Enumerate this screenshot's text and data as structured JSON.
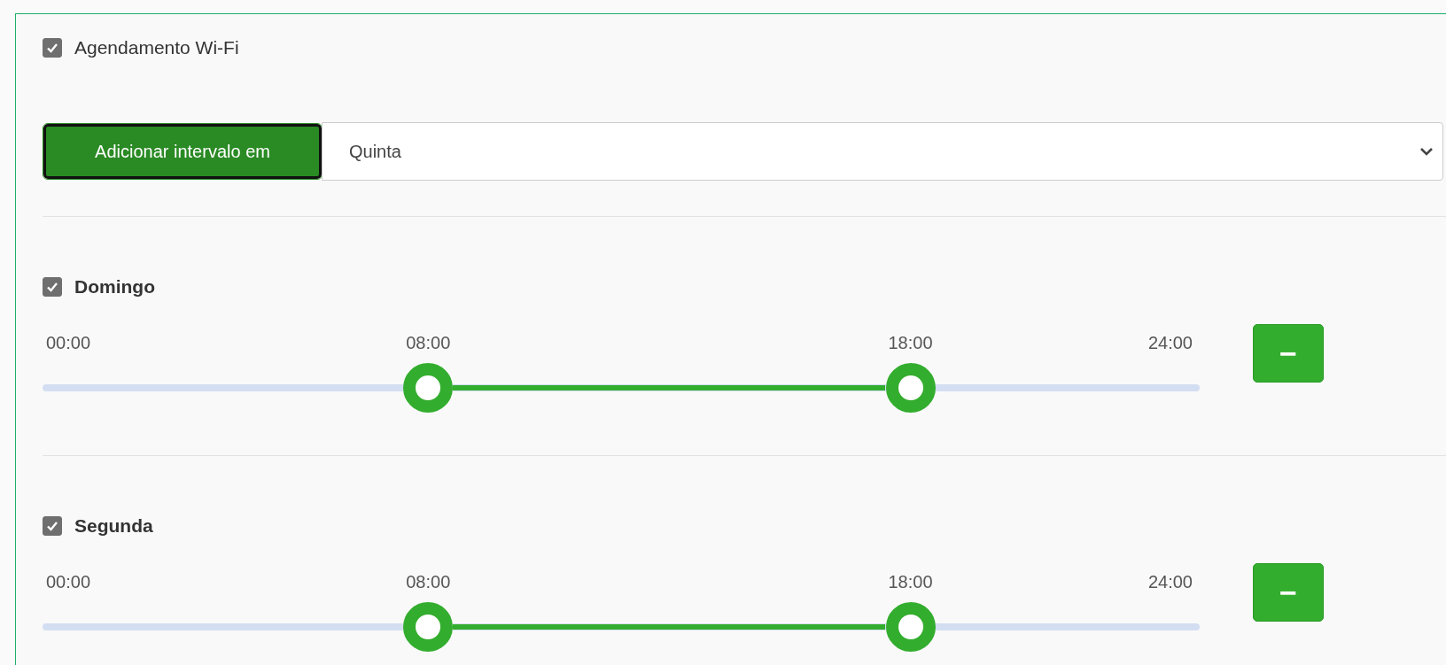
{
  "schedule": {
    "label": "Agendamento Wi-Fi",
    "checked": true
  },
  "add_interval": {
    "button": "Adicionar intervalo em",
    "day": "Quinta"
  },
  "days": [
    {
      "name": "Domingo",
      "checked": true,
      "min_label": "00:00",
      "max_label": "24:00",
      "start": {
        "label": "08:00",
        "level": 0.3333
      },
      "end": {
        "label": "18:00",
        "level": 0.75
      },
      "remove_button": "−"
    },
    {
      "name": "Segunda",
      "checked": true,
      "min_label": "00:00",
      "max_label": "24:00",
      "start": {
        "label": "08:00",
        "level": 0.3333
      },
      "end": {
        "label": "18:00",
        "level": 0.75
      },
      "remove_button": "−"
    }
  ]
}
